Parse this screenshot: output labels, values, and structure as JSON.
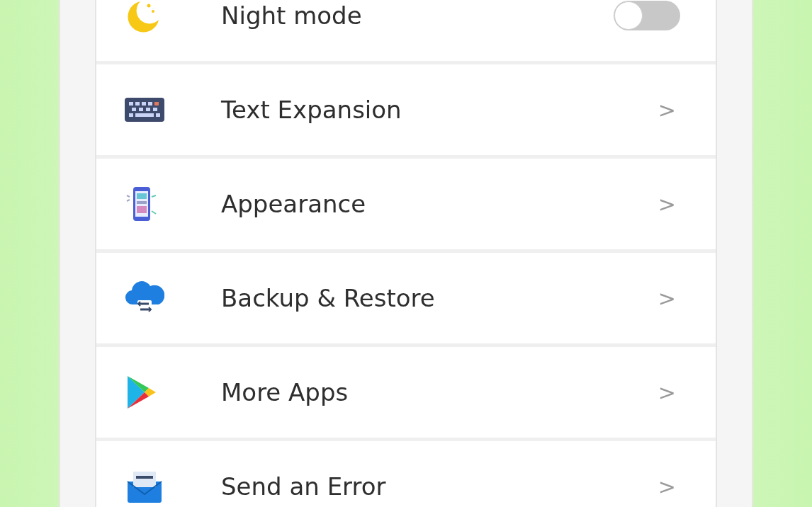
{
  "settings": [
    {
      "kind": "toggle",
      "label": "Night mode",
      "on": false
    },
    {
      "kind": "link",
      "label": "Text Expansion",
      "chevron": ">"
    },
    {
      "kind": "link",
      "label": "Appearance",
      "chevron": ">"
    },
    {
      "kind": "link",
      "label": "Backup & Restore",
      "chevron": ">"
    },
    {
      "kind": "link",
      "label": "More Apps",
      "chevron": ">"
    },
    {
      "kind": "link",
      "label": "Send an Error",
      "chevron": ">"
    }
  ]
}
